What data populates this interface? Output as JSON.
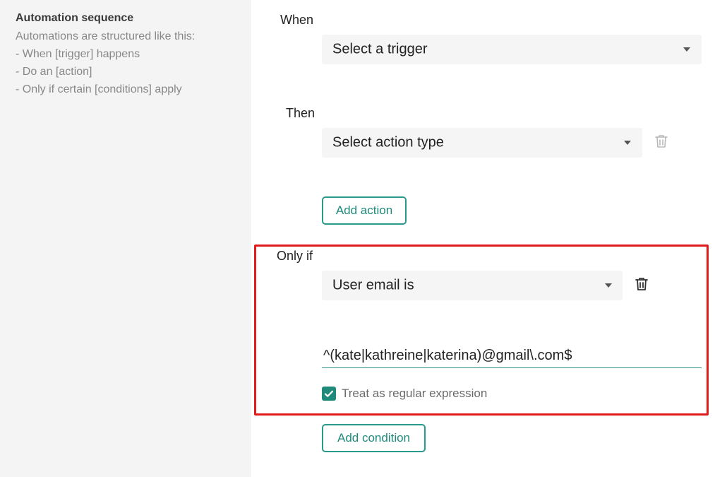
{
  "sidebar": {
    "title": "Automation sequence",
    "lines": [
      "Automations are structured like this:",
      "- When [trigger] happens",
      "- Do an [action]",
      "- Only if certain [conditions] apply"
    ]
  },
  "when": {
    "label": "When",
    "trigger_select": "Select a trigger"
  },
  "then": {
    "label": "Then",
    "action_select": "Select action type",
    "add_action_label": "Add action"
  },
  "only_if": {
    "label": "Only if",
    "condition_select": "User email is",
    "value": "^(kate|kathreine|katerina)@gmail\\.com$",
    "regex_checkbox_label": "Treat as regular expression",
    "regex_checked": true,
    "add_condition_label": "Add condition"
  },
  "colors": {
    "accent": "#1f8a7a",
    "highlight": "#e11b1b",
    "sidebar_bg": "#f4f4f4"
  },
  "icons": {
    "trash": "trash-icon",
    "dropdown": "chevron-down-icon",
    "check": "check-icon"
  }
}
